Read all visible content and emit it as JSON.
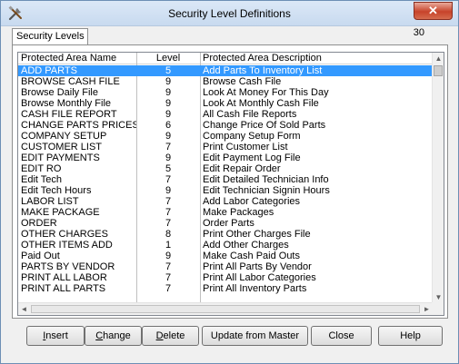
{
  "window": {
    "title": "Security Level Definitions",
    "close_glyph": "✕"
  },
  "tab": {
    "label": "Security Levels"
  },
  "record_count": "30",
  "grid": {
    "columns": [
      "Protected Area Name",
      "Level",
      "Protected Area Description"
    ],
    "rows": [
      {
        "name": "ADD PARTS",
        "level": "5",
        "desc": "Add Parts To Inventory List",
        "selected": true
      },
      {
        "name": "BROWSE CASH FILE",
        "level": "9",
        "desc": "Browse Cash File"
      },
      {
        "name": "Browse Daily File",
        "level": "9",
        "desc": "Look At Money For This Day"
      },
      {
        "name": "Browse Monthly File",
        "level": "9",
        "desc": "Look At Monthly Cash File"
      },
      {
        "name": "CASH FILE REPORT",
        "level": "9",
        "desc": "All Cash File Reports"
      },
      {
        "name": "CHANGE PARTS PRICES",
        "level": "6",
        "desc": "Change Price Of Sold Parts"
      },
      {
        "name": "COMPANY SETUP",
        "level": "9",
        "desc": "Company Setup Form"
      },
      {
        "name": "CUSTOMER LIST",
        "level": "7",
        "desc": "Print Customer List"
      },
      {
        "name": "EDIT PAYMENTS",
        "level": "9",
        "desc": "Edit Payment Log File"
      },
      {
        "name": "EDIT RO",
        "level": "5",
        "desc": "Edit Repair Order"
      },
      {
        "name": "Edit Tech",
        "level": "7",
        "desc": "Edit Detailed Technician Info"
      },
      {
        "name": "Edit Tech Hours",
        "level": "9",
        "desc": "Edit Technician Signin Hours"
      },
      {
        "name": "LABOR LIST",
        "level": "7",
        "desc": "Add Labor Categories"
      },
      {
        "name": "MAKE PACKAGE",
        "level": "7",
        "desc": "Make Packages"
      },
      {
        "name": "ORDER",
        "level": "7",
        "desc": "Order Parts"
      },
      {
        "name": "OTHER CHARGES",
        "level": "8",
        "desc": "Print Other Charges File"
      },
      {
        "name": "OTHER ITEMS ADD",
        "level": "1",
        "desc": "Add Other Charges"
      },
      {
        "name": "Paid Out",
        "level": "9",
        "desc": "Make Cash Paid Outs"
      },
      {
        "name": "PARTS BY VENDOR",
        "level": "7",
        "desc": "Print All Parts By Vendor"
      },
      {
        "name": "PRINT ALL LABOR",
        "level": "7",
        "desc": "Print All Labor Categories"
      },
      {
        "name": "PRINT ALL PARTS",
        "level": "7",
        "desc": "Print All Inventory Parts"
      }
    ]
  },
  "buttons": {
    "insert_pre": "",
    "insert_ul": "I",
    "insert_post": "nsert",
    "change_pre": "",
    "change_ul": "C",
    "change_post": "hange",
    "delete_pre": "",
    "delete_ul": "D",
    "delete_post": "elete",
    "update": "Update from Master",
    "close": "Close",
    "help": "Help"
  },
  "icons": {
    "app": "tools-icon",
    "scroll_up": "▲",
    "scroll_down": "▼",
    "scroll_left": "◄",
    "scroll_right": "►"
  },
  "colors": {
    "selection": "#3399ff",
    "close_button": "#c7432a"
  }
}
